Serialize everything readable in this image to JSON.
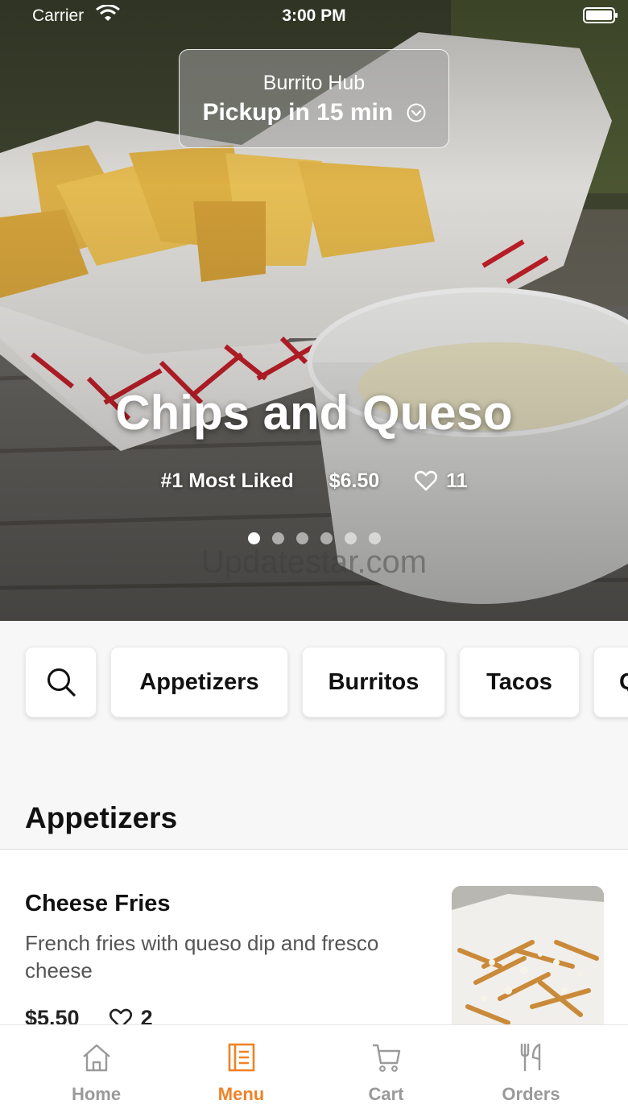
{
  "status_bar": {
    "carrier": "Carrier",
    "time": "3:00 PM"
  },
  "pickup": {
    "store": "Burrito Hub",
    "time_label": "Pickup in 15 min"
  },
  "hero": {
    "title": "Chips and Queso",
    "rank": "#1 Most Liked",
    "price": "$6.50",
    "likes": "11",
    "slide_count": 6,
    "active_slide": 1,
    "watermark": "Updatestar.com"
  },
  "categories": [
    "Appetizers",
    "Burritos",
    "Tacos",
    "Q"
  ],
  "section": {
    "title": "Appetizers"
  },
  "items": [
    {
      "name": "Cheese Fries",
      "description": "French fries with queso dip and fresco cheese",
      "price": "$5.50",
      "likes": "2"
    }
  ],
  "tabbar": {
    "home": "Home",
    "menu": "Menu",
    "cart": "Cart",
    "orders": "Orders",
    "active": "menu"
  },
  "colors": {
    "accent": "#f08227",
    "inactive": "#9a9a9a"
  },
  "icons": [
    "wifi-icon",
    "battery-icon",
    "chevron-down-icon",
    "heart-icon",
    "search-icon",
    "home-icon",
    "menu-icon",
    "cart-icon",
    "orders-icon"
  ]
}
